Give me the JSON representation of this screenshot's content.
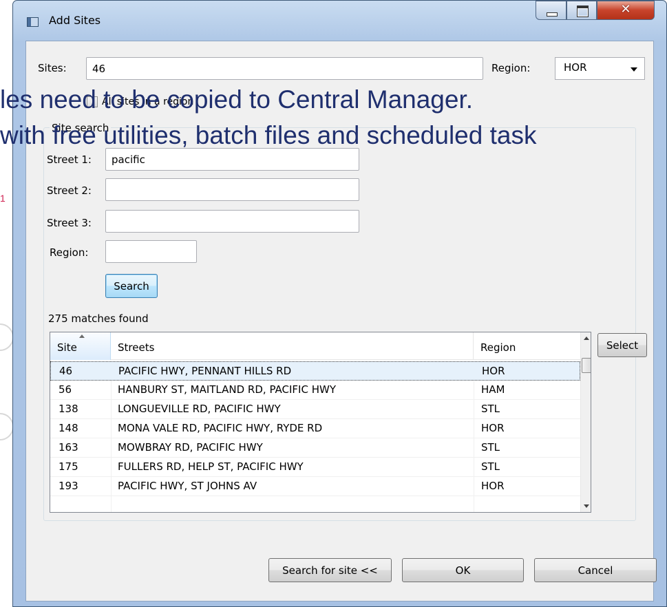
{
  "window": {
    "title": "Add Sites"
  },
  "background": {
    "line1": "les need to be copied to Central Manager.",
    "line2": "with free utilities, batch files and scheduled task",
    "mark": "1"
  },
  "form": {
    "sites_label": "Sites:",
    "sites_value": "46",
    "region_label": "Region:",
    "region_value": "HOR",
    "all_sites_label": "All sites in a region",
    "all_sites_checked": false
  },
  "site_search": {
    "group_label": "Site search",
    "street1_label": "Street 1:",
    "street1_value": "pacific",
    "street2_label": "Street 2:",
    "street2_value": "",
    "street3_label": "Street 3:",
    "street3_value": "",
    "region_label": "Region:",
    "region_value": "",
    "search_button": "Search",
    "matches_text": "275 matches found"
  },
  "results": {
    "columns": [
      "Site",
      "Streets",
      "Region"
    ],
    "sorted_column": "Site",
    "rows": [
      {
        "site": "46",
        "streets": "PACIFIC HWY, PENNANT HILLS RD",
        "region": "HOR",
        "selected": true
      },
      {
        "site": "56",
        "streets": "HANBURY ST, MAITLAND RD, PACIFIC HWY",
        "region": "HAM",
        "selected": false
      },
      {
        "site": "138",
        "streets": "LONGUEVILLE RD, PACIFIC HWY",
        "region": "STL",
        "selected": false
      },
      {
        "site": "148",
        "streets": "MONA VALE RD, PACIFIC HWY, RYDE RD",
        "region": "HOR",
        "selected": false
      },
      {
        "site": "163",
        "streets": "MOWBRAY RD, PACIFIC HWY",
        "region": "STL",
        "selected": false
      },
      {
        "site": "175",
        "streets": "FULLERS RD, HELP ST, PACIFIC HWY",
        "region": "STL",
        "selected": false
      },
      {
        "site": "193",
        "streets": "PACIFIC HWY, ST JOHNS AV",
        "region": "HOR",
        "selected": false
      }
    ],
    "select_button": "Select"
  },
  "footer": {
    "search_toggle_button": "Search for site <<",
    "ok_button": "OK",
    "cancel_button": "Cancel"
  }
}
